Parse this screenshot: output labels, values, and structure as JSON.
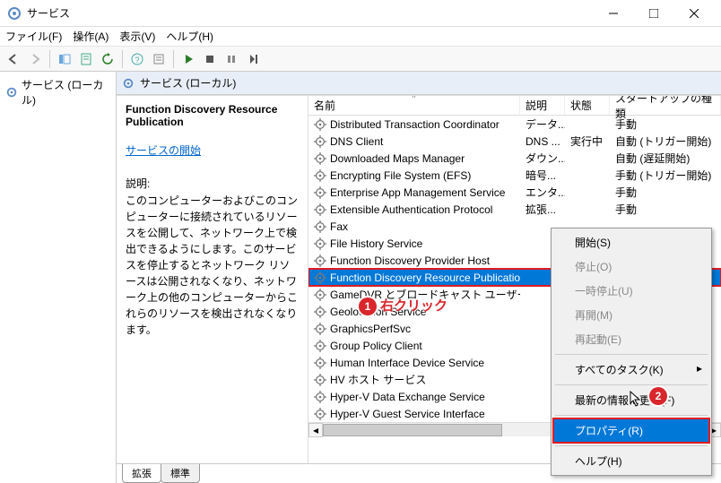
{
  "window": {
    "title": "サービス"
  },
  "menus": {
    "file": "ファイル(F)",
    "action": "操作(A)",
    "view": "表示(V)",
    "help": "ヘルプ(H)"
  },
  "tree": {
    "root": "サービス (ローカル)"
  },
  "header": {
    "label": "サービス (ローカル)"
  },
  "desc": {
    "service_name": "Function Discovery Resource Publication",
    "start_link": "サービスの開始",
    "label": "説明:",
    "text": "このコンピューターおよびこのコンピューターに接続されているリソースを公開して、ネットワーク上で検出できるようにします。このサービスを停止するとネットワーク リソースは公開されなくなり、ネットワーク上の他のコンピューターからこれらのリソースを検出されなくなります。"
  },
  "columns": {
    "name": "名前",
    "desc": "説明",
    "status": "状態",
    "startup": "スタートアップの種類"
  },
  "services": [
    {
      "name": "Distributed Transaction Coordinator",
      "desc": "データ...",
      "status": "",
      "startup": "手動"
    },
    {
      "name": "DNS Client",
      "desc": "DNS ...",
      "status": "実行中",
      "startup": "自動 (トリガー開始)"
    },
    {
      "name": "Downloaded Maps Manager",
      "desc": "ダウン...",
      "status": "",
      "startup": "自動 (遅延開始)"
    },
    {
      "name": "Encrypting File System (EFS)",
      "desc": "暗号...",
      "status": "",
      "startup": "手動 (トリガー開始)"
    },
    {
      "name": "Enterprise App Management Service",
      "desc": "エンタ...",
      "status": "",
      "startup": "手動"
    },
    {
      "name": "Extensible Authentication Protocol",
      "desc": "拡張...",
      "status": "",
      "startup": "手動"
    },
    {
      "name": "Fax",
      "desc": "",
      "status": "",
      "startup": ""
    },
    {
      "name": "File History Service",
      "desc": "",
      "status": "",
      "startup": ""
    },
    {
      "name": "Function Discovery Provider Host",
      "desc": "",
      "status": "",
      "startup": ""
    },
    {
      "name": "Function Discovery Resource Publication",
      "desc": "",
      "status": "",
      "startup": ""
    },
    {
      "name": "GameDVR とブロードキャスト ユーザー サービス_...",
      "desc": "",
      "status": "",
      "startup": ""
    },
    {
      "name": "Geolocation Service",
      "desc": "",
      "status": "",
      "startup": ""
    },
    {
      "name": "GraphicsPerfSvc",
      "desc": "",
      "status": "",
      "startup": ""
    },
    {
      "name": "Group Policy Client",
      "desc": "",
      "status": "",
      "startup": ""
    },
    {
      "name": "Human Interface Device Service",
      "desc": "",
      "status": "",
      "startup": ""
    },
    {
      "name": "HV ホスト サービス",
      "desc": "",
      "status": "",
      "startup": ""
    },
    {
      "name": "Hyper-V Data Exchange Service",
      "desc": "",
      "status": "",
      "startup": ""
    },
    {
      "name": "Hyper-V Guest Service Interface",
      "desc": "",
      "status": "",
      "startup": ""
    }
  ],
  "selected_index": 9,
  "context_menu": {
    "start": "開始(S)",
    "stop": "停止(O)",
    "pause": "一時停止(U)",
    "resume": "再開(M)",
    "restart": "再起動(E)",
    "all_tasks": "すべてのタスク(K)",
    "refresh": "最新の情報に更新(F)",
    "properties": "プロパティ(R)",
    "help": "ヘルプ(H)"
  },
  "tabs": {
    "extended": "拡張",
    "standard": "標準"
  },
  "annotations": {
    "step1": "1",
    "step1_text": "右クリック",
    "step2": "2"
  },
  "col_widths": {
    "name": 236,
    "desc": 50,
    "status": 50,
    "startup": 110
  }
}
